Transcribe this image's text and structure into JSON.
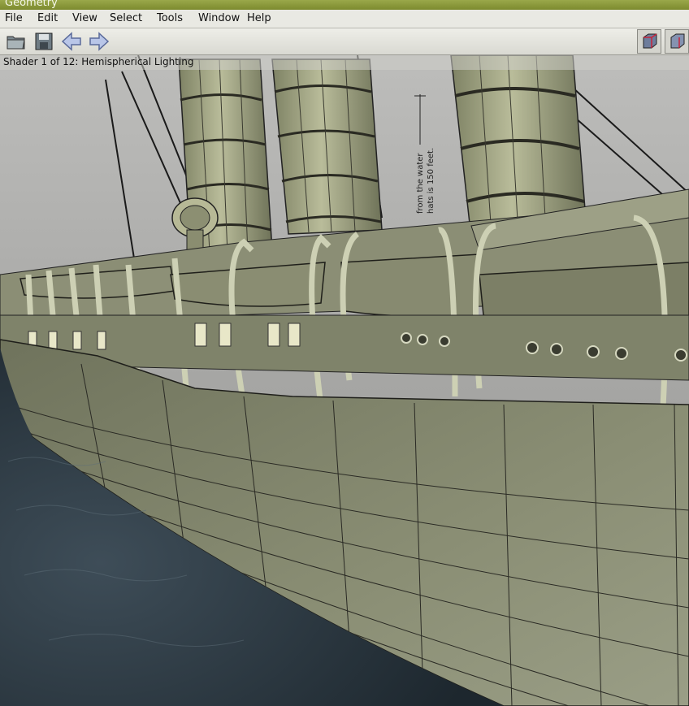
{
  "window": {
    "title": "Geometry"
  },
  "menu": [
    "File",
    "Edit",
    "View",
    "Select",
    "Tools",
    "Window",
    "Help"
  ],
  "toolbar": {
    "left": [
      "open-folder-icon",
      "save-disk-icon",
      "back-arrow-icon",
      "forward-arrow-icon"
    ],
    "right": [
      "wireframe-cube-icon",
      "shaded-cube-icon"
    ]
  },
  "viewport": {
    "shader_label": "Shader 1 of 12: Hemispherical Lighting",
    "signage_text": [
      "from the water",
      "hats is 150 feet."
    ]
  },
  "colors": {
    "titlebar": "#8a9a3a",
    "menubar": "#e9e9e3",
    "hull": "#868a70",
    "water": "#2c3a44",
    "sky": "#9b9b99"
  }
}
